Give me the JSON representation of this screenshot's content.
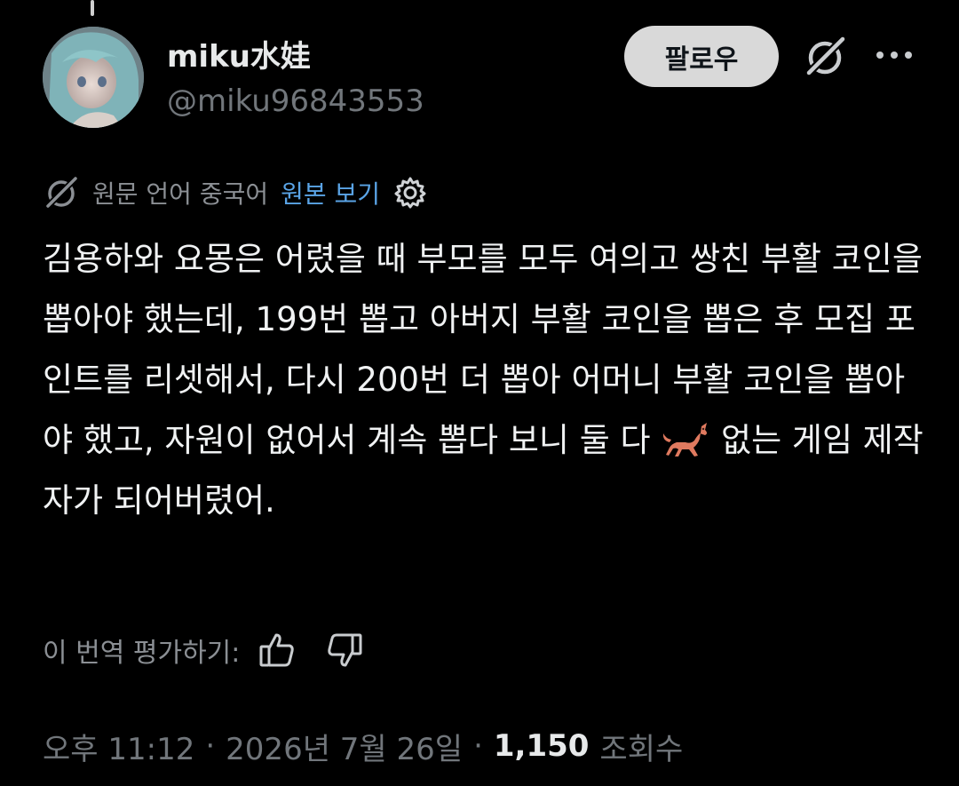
{
  "author": {
    "display_name": "miku水娃",
    "handle": "@miku96843553"
  },
  "header": {
    "follow_label": "팔로우",
    "grok_icon": "grok-slash-circle-icon",
    "more_icon": "more-dots-icon"
  },
  "translation": {
    "source_language_text": "원문 언어 중국어",
    "show_original_label": "원본 보기",
    "settings_icon": "gear-icon"
  },
  "tweet": {
    "text_part1": "김용하와 요몽은 어렸을 때 부모를 모두 여의고 쌍친 부활 코인을 뽑아야 했는데, 199번 뽑고 아버지 부활 코인을 뽑은 후 모집 포인트를 리셋해서, 다시 200번 더 뽑아 어머니 부활 코인을 뽑아야 했고, 자원이 없어서 계속 뽑다 보니 둘 다 ",
    "emoji": "horse-emoji",
    "text_part2": " 없는 게임 제작자가 되어버렸어."
  },
  "rating": {
    "label": "이 번역 평가하기:",
    "thumbs_up_icon": "thumbs-up-icon",
    "thumbs_down_icon": "thumbs-down-icon"
  },
  "meta": {
    "time": "오후 11:12",
    "date": "2026년 7월 26일",
    "separator": "·",
    "views_count": "1,150",
    "views_label": "조회수"
  },
  "colors": {
    "background": "#000000",
    "primary_text": "#e7e9ea",
    "secondary_text": "#71767b",
    "link": "#5aa4e6",
    "follow_button_bg": "#d9d9d9"
  }
}
